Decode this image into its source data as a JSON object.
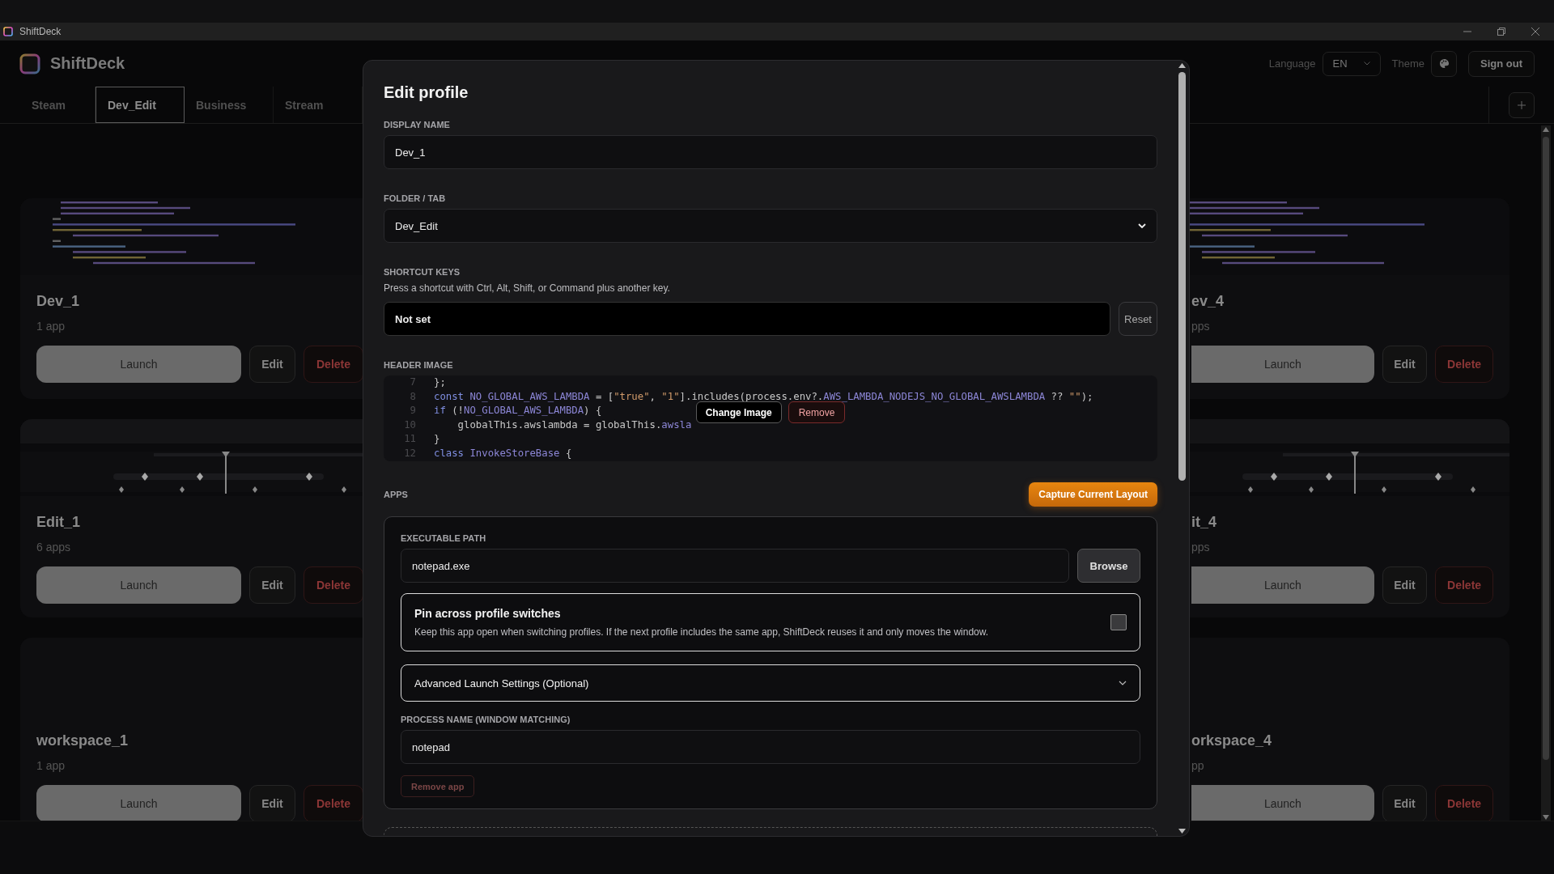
{
  "window": {
    "title": "ShiftDeck"
  },
  "app": {
    "name": "ShiftDeck"
  },
  "header": {
    "language_label": "Language",
    "language_value": "EN",
    "theme_label": "Theme",
    "sign_out": "Sign out"
  },
  "tabs": [
    {
      "label": "Steam",
      "selected": false
    },
    {
      "label": "Dev_Edit",
      "selected": true
    },
    {
      "label": "Business",
      "selected": false
    },
    {
      "label": "Stream",
      "selected": false
    }
  ],
  "profiles_left": [
    {
      "name": "Dev_1",
      "count": "1 app",
      "kind": "code",
      "launch": "Launch",
      "edit": "Edit",
      "delete": "Delete"
    },
    {
      "name": "Edit_1",
      "count": "6 apps",
      "kind": "timeline",
      "launch": "Launch",
      "edit": "Edit",
      "delete": "Delete"
    },
    {
      "name": "workspace_1",
      "count": "1 app",
      "kind": "blank",
      "launch": "Launch",
      "edit": "Edit",
      "delete": "Delete"
    }
  ],
  "profiles_right": [
    {
      "name": "ev_4",
      "count": "pps",
      "kind": "code",
      "launch": "Launch",
      "edit": "Edit",
      "delete": "Delete"
    },
    {
      "name": "it_4",
      "count": "pps",
      "kind": "timeline",
      "launch": "Launch",
      "edit": "Edit",
      "delete": "Delete"
    },
    {
      "name": "orkspace_4",
      "count": "pp",
      "kind": "blank",
      "launch": "Launch",
      "edit": "Edit",
      "delete": "Delete"
    }
  ],
  "modal": {
    "title": "Edit profile",
    "display_name": {
      "label": "DISPLAY NAME",
      "value": "Dev_1"
    },
    "folder": {
      "label": "FOLDER / TAB",
      "value": "Dev_Edit"
    },
    "shortcut": {
      "label": "SHORTCUT KEYS",
      "help": "Press a shortcut with Ctrl, Alt, Shift, or Command plus another key.",
      "value": "Not set",
      "reset": "Reset"
    },
    "header_image": {
      "label": "HEADER IMAGE",
      "change": "Change Image",
      "remove": "Remove",
      "code_lines": [
        {
          "number": "7",
          "tokens": [
            {
              "kind": "plain",
              "text": "};"
            }
          ]
        },
        {
          "number": "8",
          "tokens": [
            {
              "kind": "keyword",
              "text": "const "
            },
            {
              "kind": "ident",
              "text": "NO_GLOBAL_AWS_LAMBDA"
            },
            {
              "kind": "plain",
              "text": " = ["
            },
            {
              "kind": "string",
              "text": "\"true\""
            },
            {
              "kind": "plain",
              "text": ", "
            },
            {
              "kind": "string",
              "text": "\"1\""
            },
            {
              "kind": "plain",
              "text": "].includes(process.env?."
            },
            {
              "kind": "ident",
              "text": "AWS_LAMBDA_NODEJS_NO_GLOBAL_AWSLAMBDA"
            },
            {
              "kind": "plain",
              "text": " ?? "
            },
            {
              "kind": "string",
              "text": "\"\""
            },
            {
              "kind": "plain",
              "text": ");"
            }
          ]
        },
        {
          "number": "9",
          "tokens": [
            {
              "kind": "keyword",
              "text": "if "
            },
            {
              "kind": "plain",
              "text": "(!"
            },
            {
              "kind": "ident",
              "text": "NO_GLOBAL_AWS_LAMBDA"
            },
            {
              "kind": "plain",
              "text": ") {"
            }
          ]
        },
        {
          "number": "10",
          "tokens": [
            {
              "kind": "plain",
              "text": "    globalThis.awslambda = globalThis."
            },
            {
              "kind": "ident",
              "text": "awsla"
            }
          ]
        },
        {
          "number": "11",
          "tokens": [
            {
              "kind": "plain",
              "text": "}"
            }
          ]
        },
        {
          "number": "12",
          "tokens": [
            {
              "kind": "keyword",
              "text": "class "
            },
            {
              "kind": "ident",
              "text": "InvokeStoreBase"
            },
            {
              "kind": "plain",
              "text": " {"
            }
          ]
        }
      ]
    },
    "apps": {
      "label": "APPS",
      "capture": "Capture Current Layout",
      "exe_label": "EXECUTABLE PATH",
      "exe_value": "notepad.exe",
      "browse": "Browse",
      "pin": {
        "title": "Pin across profile switches",
        "text": "Keep this app open when switching profiles. If the next profile includes the same app, ShiftDeck reuses it and only moves the window.",
        "checked": false
      },
      "advanced": {
        "label": "Advanced Launch Settings (Optional)",
        "expanded": false
      },
      "process_label": "PROCESS NAME (WINDOW MATCHING)",
      "process_value": "notepad",
      "remove_app": "Remove app"
    }
  }
}
